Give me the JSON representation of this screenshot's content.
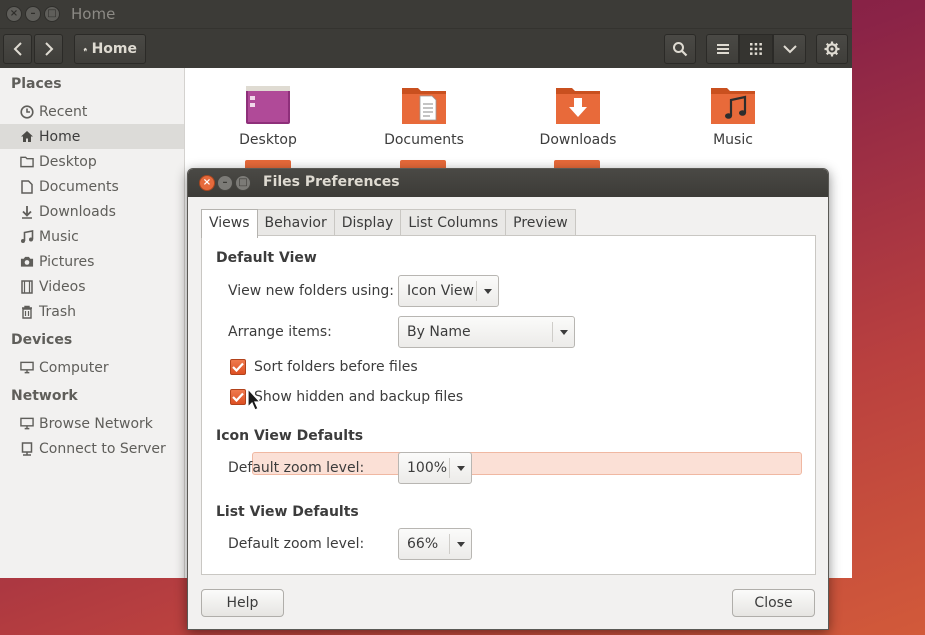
{
  "main_window": {
    "title": "Home",
    "toolbar": {
      "path_button": "Home"
    },
    "sidebar": {
      "sections": [
        {
          "heading": "Places",
          "items": [
            {
              "label": "Recent",
              "icon": "clock-icon"
            },
            {
              "label": "Home",
              "icon": "home-icon",
              "active": true
            },
            {
              "label": "Desktop",
              "icon": "folder-icon"
            },
            {
              "label": "Documents",
              "icon": "document-icon"
            },
            {
              "label": "Downloads",
              "icon": "download-icon"
            },
            {
              "label": "Music",
              "icon": "music-icon"
            },
            {
              "label": "Pictures",
              "icon": "camera-icon"
            },
            {
              "label": "Videos",
              "icon": "film-icon"
            },
            {
              "label": "Trash",
              "icon": "trash-icon"
            }
          ]
        },
        {
          "heading": "Devices",
          "items": [
            {
              "label": "Computer",
              "icon": "computer-icon"
            }
          ]
        },
        {
          "heading": "Network",
          "items": [
            {
              "label": "Browse Network",
              "icon": "network-icon"
            },
            {
              "label": "Connect to Server",
              "icon": "server-icon"
            }
          ]
        }
      ]
    },
    "files": [
      {
        "name": "Desktop",
        "icon": "desktop-folder-icon"
      },
      {
        "name": "Documents",
        "icon": "documents-folder-icon"
      },
      {
        "name": "Downloads",
        "icon": "downloads-folder-icon"
      },
      {
        "name": "Music",
        "icon": "music-folder-icon"
      }
    ]
  },
  "dialog": {
    "title": "Files Preferences",
    "tabs": [
      "Views",
      "Behavior",
      "Display",
      "List Columns",
      "Preview"
    ],
    "active_tab": "Views",
    "default_view": {
      "heading": "Default View",
      "view_new_folders_label": "View new folders using:",
      "view_new_folders_value": "Icon View",
      "arrange_items_label": "Arrange items:",
      "arrange_items_value": "By Name",
      "sort_folders_label": "Sort folders before files",
      "sort_folders_checked": true,
      "show_hidden_label": "Show hidden and backup files",
      "show_hidden_checked": true
    },
    "icon_view_defaults": {
      "heading": "Icon View Defaults",
      "zoom_label": "Default zoom level:",
      "zoom_value": "100%"
    },
    "list_view_defaults": {
      "heading": "List View Defaults",
      "zoom_label": "Default zoom level:",
      "zoom_value": "66%"
    },
    "help_button": "Help",
    "close_button": "Close"
  },
  "colors": {
    "accent": "#dd4f22",
    "titlebar": "#3c3b37",
    "folder_orange": "#e86a3a",
    "desktop_purple": "#a23a86"
  }
}
